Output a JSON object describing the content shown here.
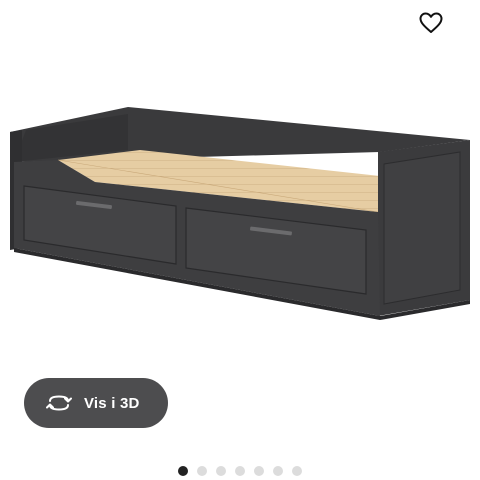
{
  "gallery": {
    "wishlist_icon": "heart-icon",
    "view3d": {
      "label": "Vis i 3D",
      "icon": "rotate-3d-icon"
    },
    "slides": {
      "total": 7,
      "active_index": 0
    }
  },
  "colors": {
    "frame": "#3d3d3f",
    "slats": "#e6cda3",
    "button": "#4d4d4f",
    "dot_active": "#222222",
    "dot_inactive": "#dcdcdc"
  }
}
